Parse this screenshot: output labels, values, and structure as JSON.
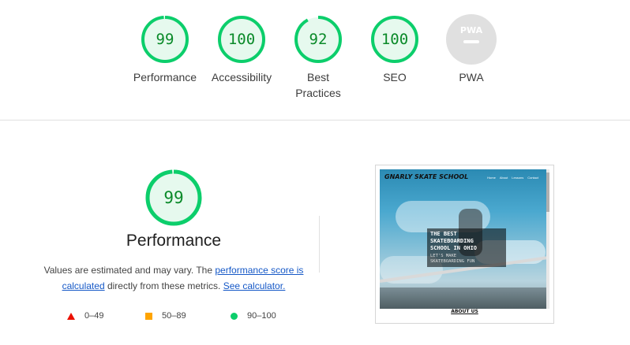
{
  "summary": {
    "gauges": [
      {
        "label": "Performance",
        "score": "99",
        "value": 99
      },
      {
        "label": "Accessibility",
        "score": "100",
        "value": 100
      },
      {
        "label": "Best Practices",
        "score": "92",
        "value": 92
      },
      {
        "label": "SEO",
        "score": "100",
        "value": 100
      },
      {
        "label": "PWA",
        "score": "",
        "value": null
      }
    ],
    "pwa_badge": "PWA"
  },
  "performance": {
    "score": "99",
    "value": 99,
    "title": "Performance",
    "desc_prefix": "Values are estimated and may vary. The",
    "link_score": "performance score is calculated",
    "desc_middle": "directly from these metrics.",
    "link_calc": "See calculator."
  },
  "legend": [
    {
      "shape": "triangle",
      "label": "0–49",
      "color": "#eb0f00"
    },
    {
      "shape": "square",
      "label": "50–89",
      "color": "#ffa400"
    },
    {
      "shape": "circle",
      "label": "90–100",
      "color": "#0cce6b"
    }
  ],
  "screenshot": {
    "brand": "GNARLY SKATE SCHOOL",
    "nav": [
      "Home",
      "About",
      "Lessons",
      "Contact"
    ],
    "hero_lines": [
      "THE BEST",
      "SKATEBOARDING",
      "SCHOOL IN OHIO"
    ],
    "hero_sub": [
      "LET'S MAKE",
      "SKATEBOARDING FUN"
    ],
    "footer_heading": "ABOUT US"
  },
  "colors": {
    "pass": "#0cce6b",
    "pass_bg": "#e6f9ee",
    "pass_text": "#0a8a29",
    "pwa_grey": "#e0e0e0"
  }
}
